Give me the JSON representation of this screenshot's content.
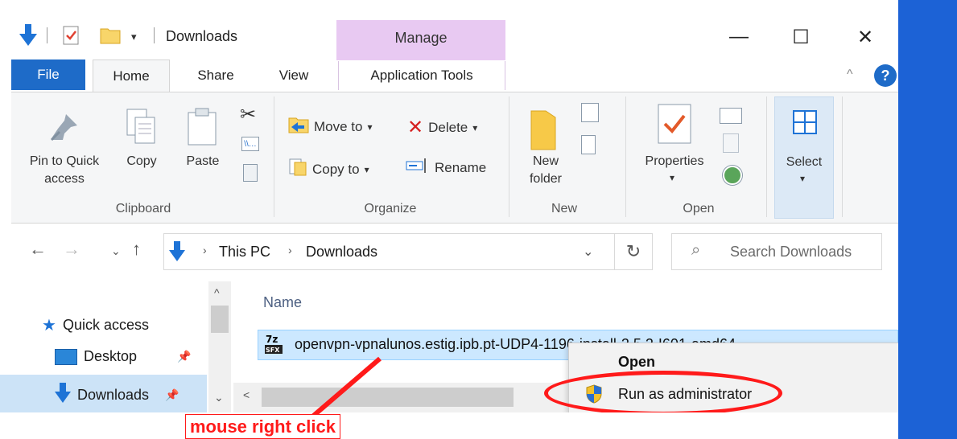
{
  "window": {
    "title": "Downloads",
    "contextual_tab_group": "Manage",
    "controls": {
      "minimize": "—",
      "maximize": "☐",
      "close": "✕"
    }
  },
  "ribbon_tabs": [
    "File",
    "Home",
    "Share",
    "View",
    "Application Tools"
  ],
  "ribbon": {
    "clipboard": {
      "label": "Clipboard",
      "pin_line1": "Pin to Quick",
      "pin_line2": "access",
      "copy": "Copy",
      "paste": "Paste"
    },
    "organize": {
      "label": "Organize",
      "move_to": "Move to",
      "copy_to": "Copy to",
      "delete": "Delete",
      "rename": "Rename"
    },
    "new": {
      "label": "New",
      "new_folder_line1": "New",
      "new_folder_line2": "folder"
    },
    "open": {
      "label": "Open",
      "properties": "Properties"
    },
    "select": {
      "label": "Select"
    }
  },
  "address": {
    "crumbs": [
      "This PC",
      "Downloads"
    ],
    "search_placeholder": "Search Downloads"
  },
  "nav_pane": {
    "items": [
      "Quick access",
      "Desktop",
      "Downloads"
    ]
  },
  "file_list": {
    "column_name": "Name",
    "file_name": "openvpn-vpnalunos.estig.ipb.pt-UDP4-1196-install-2.5.2-I601-amd64"
  },
  "context_menu": {
    "items": [
      "Open",
      "Run as administrator"
    ]
  },
  "annotation": {
    "text": "mouse right click",
    "color": "#ff1a1a"
  },
  "colors": {
    "file_tab": "#1e6bc8",
    "manage_tab": "#e8c9f2",
    "selection": "#cce8ff",
    "desktop": "#1c62d6"
  }
}
